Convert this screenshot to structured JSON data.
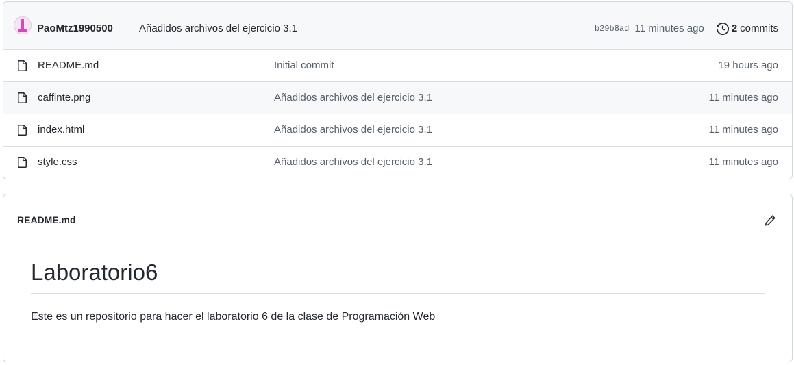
{
  "commit": {
    "author": "PaoMtz1990500",
    "message": "Añadidos archivos del ejercicio 3.1",
    "sha": "b29b8ad",
    "time": "11 minutes ago",
    "count": "2",
    "count_label": "commits"
  },
  "files": [
    {
      "name": "README.md",
      "message": "Initial commit",
      "age": "19 hours ago"
    },
    {
      "name": "caffinte.png",
      "message": "Añadidos archivos del ejercicio 3.1",
      "age": "11 minutes ago"
    },
    {
      "name": "index.html",
      "message": "Añadidos archivos del ejercicio 3.1",
      "age": "11 minutes ago"
    },
    {
      "name": "style.css",
      "message": "Añadidos archivos del ejercicio 3.1",
      "age": "11 minutes ago"
    }
  ],
  "readme": {
    "filename": "README.md",
    "heading": "Laboratorio6",
    "body": "Este es un repositorio para hacer el laboratorio 6 de la clase de Programación Web"
  },
  "icons": {
    "file": "file-icon",
    "history": "history-icon",
    "edit": "pencil-icon"
  }
}
